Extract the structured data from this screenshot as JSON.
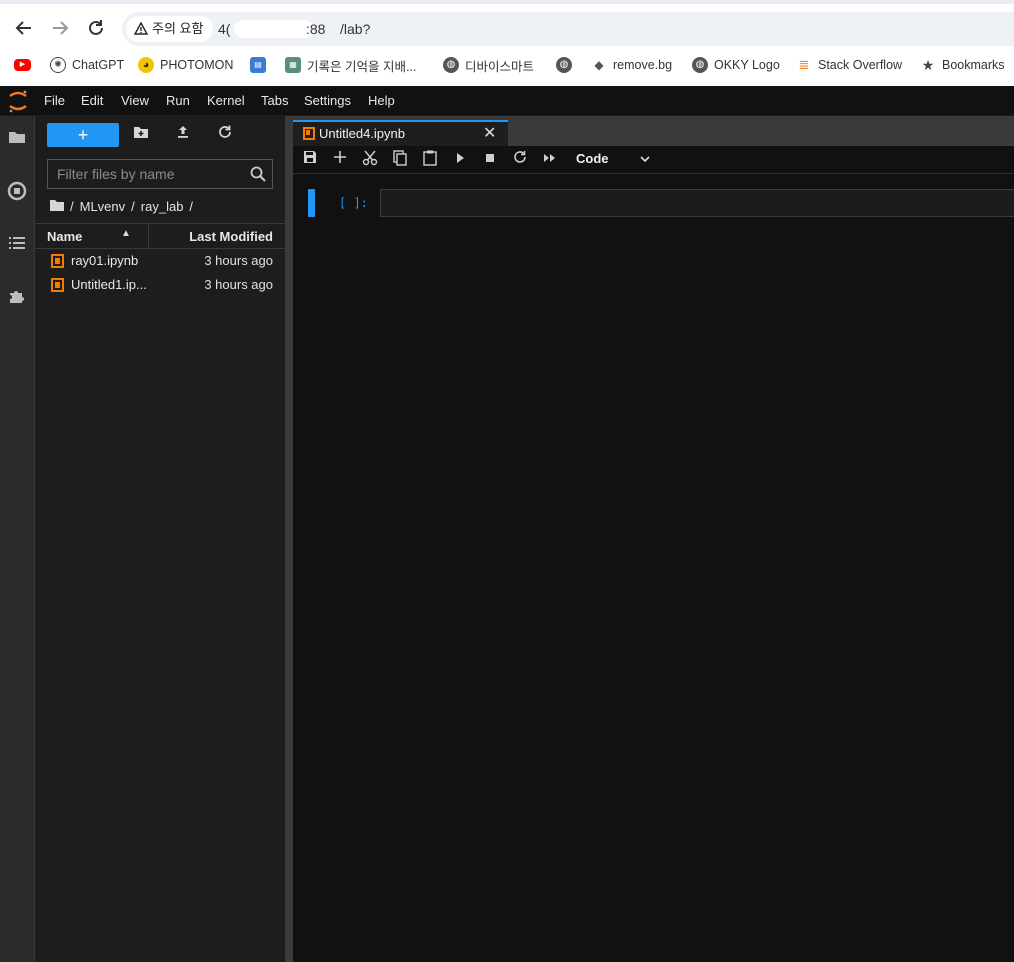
{
  "browser": {
    "warning": "주의 요함",
    "url_prefix": "4(",
    "url_port": ":88",
    "url_path": "/lab?"
  },
  "bookmarks": [
    {
      "label": ""
    },
    {
      "label": "ChatGPT"
    },
    {
      "label": "PHOTOMON"
    },
    {
      "label": ""
    },
    {
      "label": "기록은 기억을 지배..."
    },
    {
      "label": "디바이스마트"
    },
    {
      "label": ""
    },
    {
      "label": "remove.bg"
    },
    {
      "label": "OKKY Logo"
    },
    {
      "label": "Stack Overflow"
    },
    {
      "label": "Bookmarks"
    }
  ],
  "menu": [
    "File",
    "Edit",
    "View",
    "Run",
    "Kernel",
    "Tabs",
    "Settings",
    "Help"
  ],
  "filebrowser": {
    "new_label": "+",
    "filter_placeholder": "Filter files by name",
    "breadcrumb": [
      "/",
      "MLvenv",
      "/",
      "ray_lab",
      "/"
    ],
    "col_name": "Name",
    "col_modified": "Last Modified",
    "files": [
      {
        "name": "ray01.ipynb",
        "modified": "3 hours ago"
      },
      {
        "name": "Untitled1.ip...",
        "modified": "3 hours ago"
      }
    ]
  },
  "notebook": {
    "tab_label": "Untitled4.ipynb",
    "tab_close": "✕",
    "cell_type": "Code",
    "prompt": "[ ]:"
  },
  "colors": {
    "accent": "#2196f3",
    "notebook_icon": "#f57c00",
    "background": "#111111"
  }
}
